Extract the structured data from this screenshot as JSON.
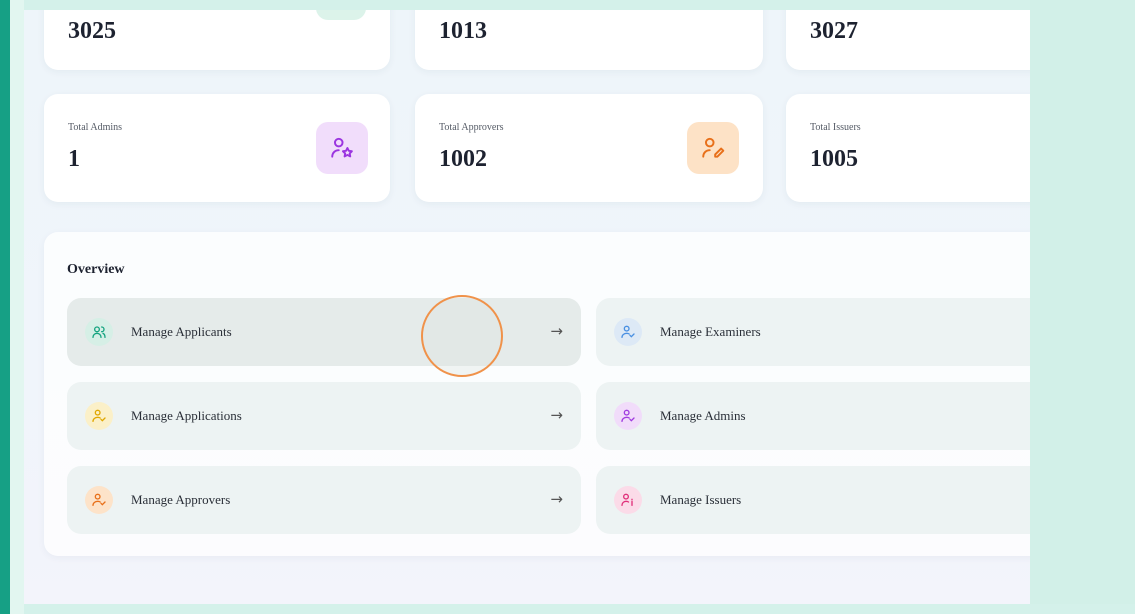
{
  "stats_row1": [
    {
      "value": "3025",
      "icon": "users-icon",
      "color": "#14a37f"
    },
    {
      "value": "1013",
      "icon": "user-check-icon",
      "color": "#4a90e2"
    },
    {
      "value": "3027"
    }
  ],
  "stats_row2": [
    {
      "label": "Total Admins",
      "value": "1",
      "icon": "user-star-icon",
      "color": "#9b35e0"
    },
    {
      "label": "Total Approvers",
      "value": "1002",
      "icon": "user-pen-icon",
      "color": "#e8701a"
    },
    {
      "label": "Total Issuers",
      "value": "1005"
    }
  ],
  "overview": {
    "title": "Overview",
    "tiles": [
      {
        "label": "Manage Applicants",
        "arrow": "→",
        "icon": "users-icon",
        "color": "#14a37f"
      },
      {
        "label": "Manage Examiners",
        "icon": "user-check-icon",
        "color": "#4a90e2"
      },
      {
        "label": "Manage Applications",
        "arrow": "→",
        "icon": "user-check-icon",
        "color": "#e0a800"
      },
      {
        "label": "Manage Admins",
        "icon": "user-check-icon",
        "color": "#a03ce0"
      },
      {
        "label": "Manage Approvers",
        "arrow": "→",
        "icon": "user-check-icon",
        "color": "#e8701a"
      },
      {
        "label": "Manage Issuers",
        "icon": "user-info-icon",
        "color": "#e0307a"
      }
    ]
  }
}
